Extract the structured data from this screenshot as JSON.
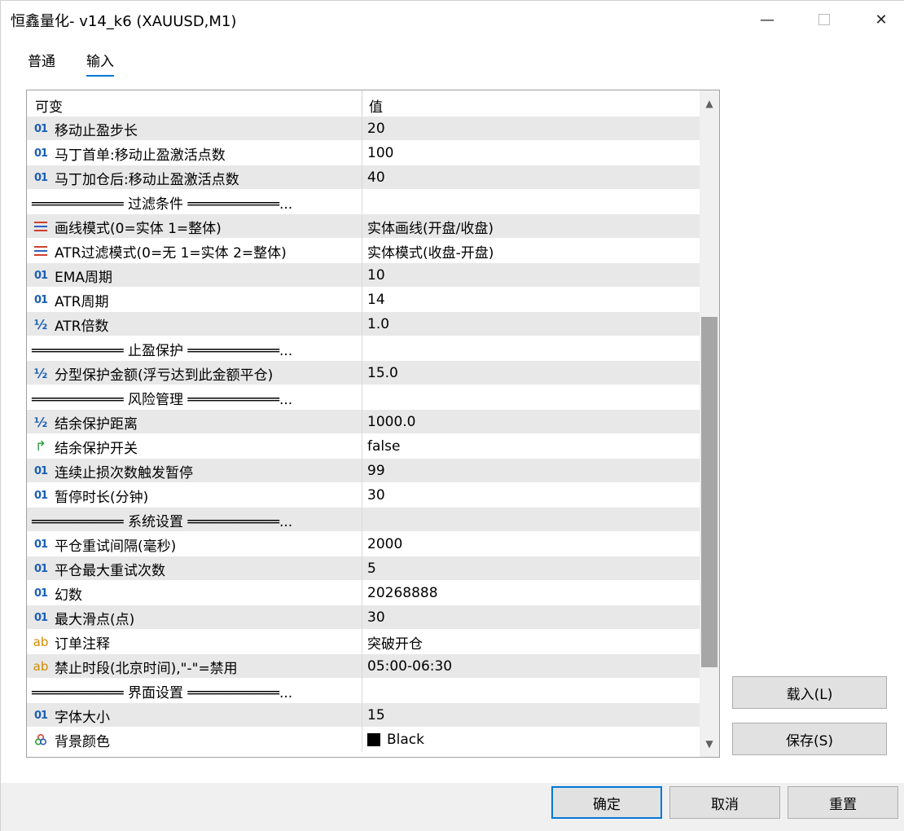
{
  "window": {
    "title": "恒鑫量化- v14_k6 (XAUUSD,M1)",
    "min_glyph": "—",
    "close_glyph": "✕"
  },
  "tabs": [
    {
      "label": "普通"
    },
    {
      "label": "输入"
    }
  ],
  "grid": {
    "header_variable": "可变",
    "header_value": "值",
    "rows": [
      {
        "type": "int",
        "name": "移动止盈步长",
        "value": "20"
      },
      {
        "type": "int",
        "name": "马丁首单:移动止盈激活点数",
        "value": "100"
      },
      {
        "type": "int",
        "name": "马丁加仓后:移动止盈激活点数",
        "value": "40"
      },
      {
        "type": "sep",
        "name": "═══════════ 过滤条件 ═══════════...",
        "value": ""
      },
      {
        "type": "enum",
        "name": "画线模式(0=实体 1=整体)",
        "value": "实体画线(开盘/收盘)"
      },
      {
        "type": "enum",
        "name": "ATR过滤模式(0=无 1=实体 2=整体)",
        "value": "实体模式(收盘-开盘)"
      },
      {
        "type": "int",
        "name": "EMA周期",
        "value": "10"
      },
      {
        "type": "int",
        "name": "ATR周期",
        "value": "14"
      },
      {
        "type": "dbl",
        "name": "ATR倍数",
        "value": "1.0"
      },
      {
        "type": "sep",
        "name": "═══════════ 止盈保护 ═══════════...",
        "value": ""
      },
      {
        "type": "dbl",
        "name": "分型保护金额(浮亏达到此金额平仓)",
        "value": "15.0"
      },
      {
        "type": "sep",
        "name": "═══════════ 风险管理 ═══════════...",
        "value": ""
      },
      {
        "type": "dbl",
        "name": "结余保护距离",
        "value": "1000.0"
      },
      {
        "type": "bool",
        "name": "结余保护开关",
        "value": "false"
      },
      {
        "type": "int",
        "name": "连续止损次数触发暂停",
        "value": "99"
      },
      {
        "type": "int",
        "name": "暂停时长(分钟)",
        "value": "30"
      },
      {
        "type": "sep",
        "name": "═══════════ 系统设置 ═══════════...",
        "value": ""
      },
      {
        "type": "int",
        "name": "平仓重试间隔(毫秒)",
        "value": "2000"
      },
      {
        "type": "int",
        "name": "平仓最大重试次数",
        "value": "5"
      },
      {
        "type": "int",
        "name": "幻数",
        "value": "20268888"
      },
      {
        "type": "int",
        "name": "最大滑点(点)",
        "value": "30"
      },
      {
        "type": "str",
        "name": "订单注释",
        "value": "突破开仓"
      },
      {
        "type": "str",
        "name": "禁止时段(北京时间),\"-\"=禁用",
        "value": "05:00-06:30"
      },
      {
        "type": "sep",
        "name": "═══════════ 界面设置 ═══════════...",
        "value": ""
      },
      {
        "type": "int",
        "name": "字体大小",
        "value": "15"
      },
      {
        "type": "color",
        "name": "背景颜色",
        "value": "Black"
      }
    ]
  },
  "icons": {
    "int": "01",
    "dbl": "½",
    "str": "ab",
    "bool": "↱",
    "color": "✿"
  },
  "buttons": {
    "load": "载入(L)",
    "save": "保存(S)",
    "ok": "确定",
    "cancel": "取消",
    "reset": "重置"
  },
  "colors": {
    "accent": "#0078d7",
    "swatch": "#000000"
  }
}
